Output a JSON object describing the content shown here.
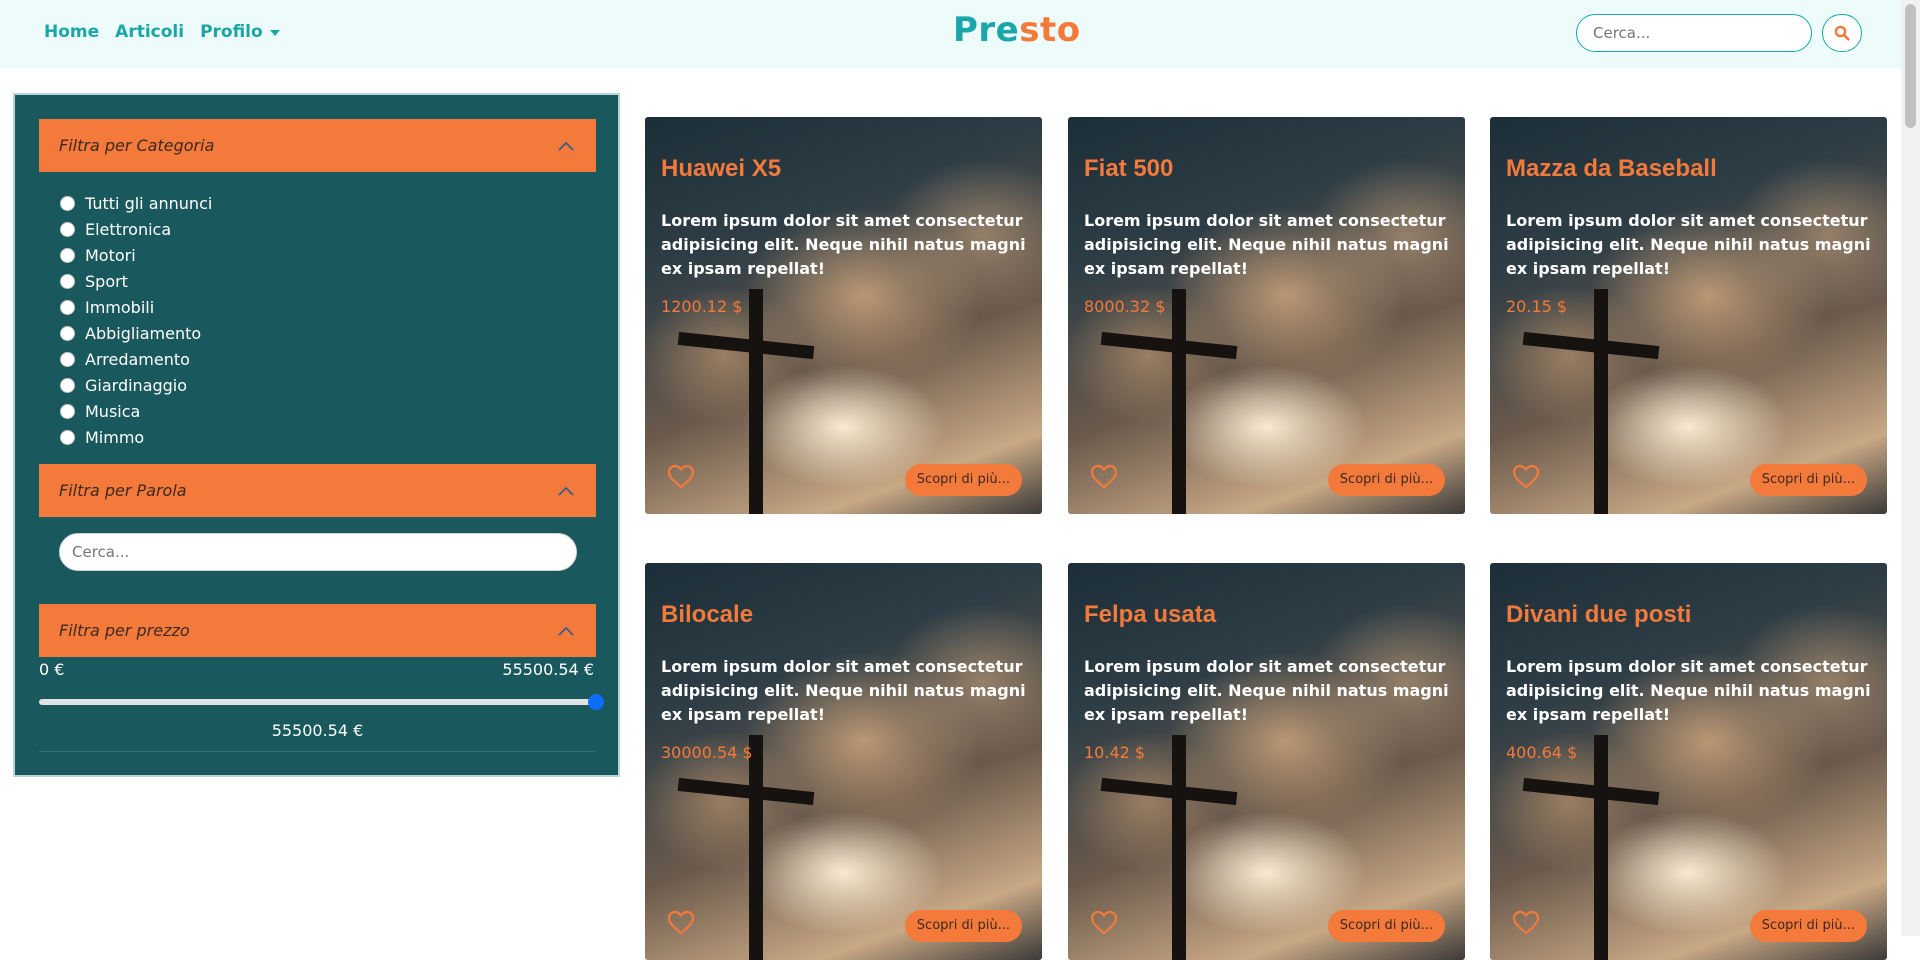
{
  "navbar": {
    "links": [
      "Home",
      "Articoli",
      "Profilo"
    ],
    "brand": {
      "part1": "Pre",
      "part2": "sto"
    },
    "search": {
      "placeholder": "Cerca..."
    }
  },
  "sidebar": {
    "category_filter": {
      "title": "Filtra per Categoria",
      "items": [
        "Tutti gli annunci",
        "Elettronica",
        "Motori",
        "Sport",
        "Immobili",
        "Abbigliamento",
        "Arredamento",
        "Giardinaggio",
        "Musica",
        "Mimmo"
      ]
    },
    "word_filter": {
      "title": "Filtra per Parola",
      "placeholder": "Cerca..."
    },
    "price_filter": {
      "title": "Filtra per prezzo",
      "min_label": "0 €",
      "max_label": "55500.54 €",
      "current_label": "55500.54 €",
      "min": 0,
      "max": 55500.54,
      "value": 55500.54
    }
  },
  "cards": [
    {
      "title": "Huawei X5",
      "description": "Lorem ipsum dolor sit amet consectetur adipisicing elit. Neque nihil natus magni ex ipsam repellat!",
      "price": "1200.12 $",
      "button": "Scopri di più..."
    },
    {
      "title": "Fiat 500",
      "description": "Lorem ipsum dolor sit amet consectetur adipisicing elit. Neque nihil natus magni ex ipsam repellat!",
      "price": "8000.32 $",
      "button": "Scopri di più..."
    },
    {
      "title": "Mazza da Baseball",
      "description": "Lorem ipsum dolor sit amet consectetur adipisicing elit. Neque nihil natus magni ex ipsam repellat!",
      "price": "20.15 $",
      "button": "Scopri di più..."
    },
    {
      "title": "Bilocale",
      "description": "Lorem ipsum dolor sit amet consectetur adipisicing elit. Neque nihil natus magni ex ipsam repellat!",
      "price": "30000.54 $",
      "button": "Scopri di più..."
    },
    {
      "title": "Felpa usata",
      "description": "Lorem ipsum dolor sit amet consectetur adipisicing elit. Neque nihil natus magni ex ipsam repellat!",
      "price": "10.42 $",
      "button": "Scopri di più..."
    },
    {
      "title": "Divani due posti",
      "description": "Lorem ipsum dolor sit amet consectetur adipisicing elit. Neque nihil natus magni ex ipsam repellat!",
      "price": "400.64 $",
      "button": "Scopri di più..."
    }
  ],
  "icons": {
    "search": "search-icon",
    "chevron": "chevron-up-icon",
    "heart": "heart-icon",
    "caret": "caret-down-icon"
  },
  "colors": {
    "primary": "#1aa7aa",
    "accent": "#f47a3b",
    "sidebar": "#19595e",
    "navbar": "#eefbfb"
  }
}
